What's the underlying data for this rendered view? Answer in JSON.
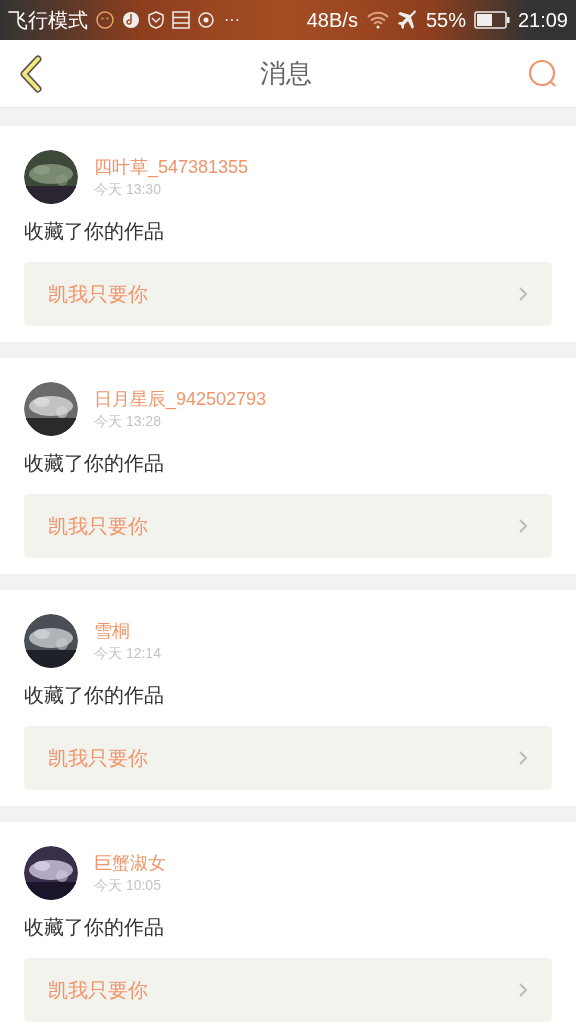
{
  "status_bar": {
    "mode": "飞行模式",
    "more": "···",
    "speed": "48B/s",
    "battery": "55%",
    "time": "21:09"
  },
  "header": {
    "title": "消息"
  },
  "messages": [
    {
      "name": "四叶草_547381355",
      "time": "今天 13:30",
      "text": "收藏了你的作品",
      "work": "凯我只要你"
    },
    {
      "name": "日月星辰_942502793",
      "time": "今天 13:28",
      "text": "收藏了你的作品",
      "work": "凯我只要你"
    },
    {
      "name": "雪桐",
      "time": "今天 12:14",
      "text": "收藏了你的作品",
      "work": "凯我只要你"
    },
    {
      "name": "巨蟹淑女",
      "time": "今天 10:05",
      "text": "收藏了你的作品",
      "work": "凯我只要你"
    }
  ]
}
